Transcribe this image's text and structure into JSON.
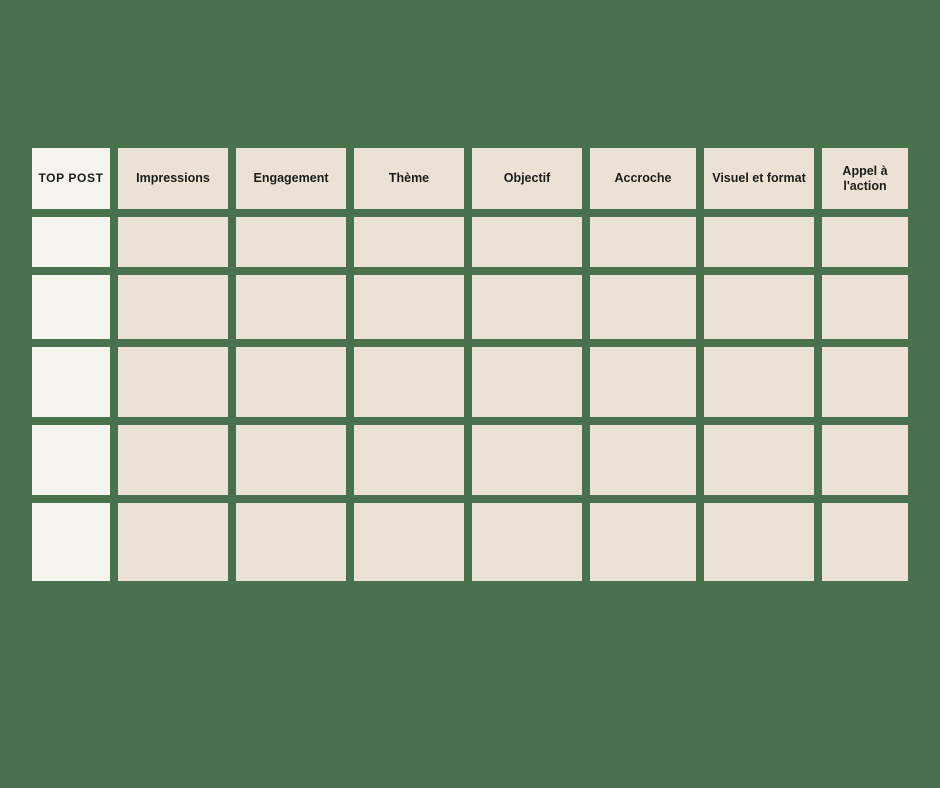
{
  "page": {
    "background_color": "#4a714d",
    "cell_color": "#ebe1d5",
    "first_column_cell_color": "#f5f4ef",
    "text_color": "#1c1c1a"
  },
  "table": {
    "name": "top-post-planner-table",
    "columns": [
      {
        "key": "top_post",
        "label": "TOP POST",
        "emphasis": "bold"
      },
      {
        "key": "impressions",
        "label": "Impressions",
        "emphasis": "semibold"
      },
      {
        "key": "engagement",
        "label": "Engagement",
        "emphasis": "semibold"
      },
      {
        "key": "theme",
        "label": "Thème",
        "emphasis": "semibold"
      },
      {
        "key": "objectif",
        "label": "Objectif",
        "emphasis": "semibold"
      },
      {
        "key": "accroche",
        "label": "Accroche",
        "emphasis": "semibold"
      },
      {
        "key": "visuel_format",
        "label": "Visuel et format",
        "emphasis": "semibold"
      },
      {
        "key": "appel_action",
        "label": "Appel à l'action",
        "emphasis": "semibold"
      }
    ],
    "rows": [
      {
        "top_post": "",
        "impressions": "",
        "engagement": "",
        "theme": "",
        "objectif": "",
        "accroche": "",
        "visuel_format": "",
        "appel_action": ""
      },
      {
        "top_post": "",
        "impressions": "",
        "engagement": "",
        "theme": "",
        "objectif": "",
        "accroche": "",
        "visuel_format": "",
        "appel_action": ""
      },
      {
        "top_post": "",
        "impressions": "",
        "engagement": "",
        "theme": "",
        "objectif": "",
        "accroche": "",
        "visuel_format": "",
        "appel_action": ""
      },
      {
        "top_post": "",
        "impressions": "",
        "engagement": "",
        "theme": "",
        "objectif": "",
        "accroche": "",
        "visuel_format": "",
        "appel_action": ""
      },
      {
        "top_post": "",
        "impressions": "",
        "engagement": "",
        "theme": "",
        "objectif": "",
        "accroche": "",
        "visuel_format": "",
        "appel_action": ""
      }
    ]
  }
}
